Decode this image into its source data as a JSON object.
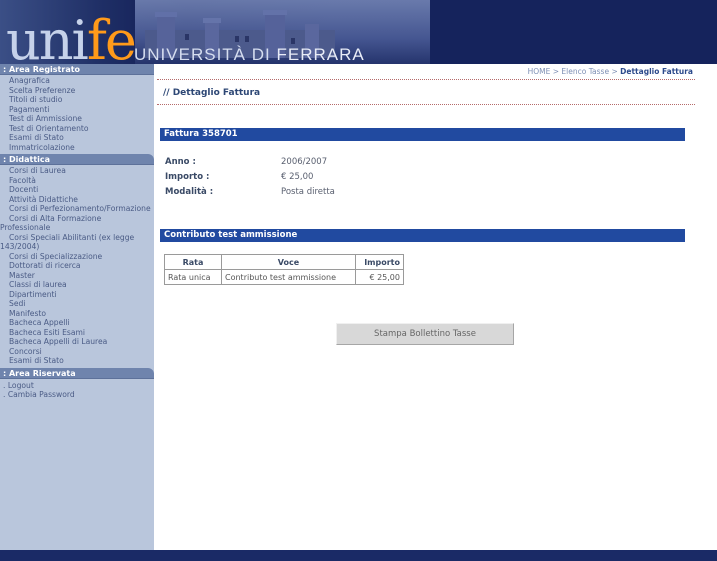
{
  "header": {
    "logo_main": "uni",
    "logo_accent": "fe",
    "logo_university": "UNIVERSITÀ DI",
    "logo_city": "FERRARA"
  },
  "sidebar": {
    "area_registrato": {
      "title": "Area Registrato",
      "items": [
        "Anagrafica",
        "Scelta Preferenze",
        "Titoli di studio",
        "Pagamenti",
        "Test di Ammissione",
        "Test di Orientamento",
        "Esami di Stato",
        "Immatricolazione"
      ]
    },
    "didattica": {
      "title": "Didattica",
      "items": [
        "Corsi di Laurea",
        "Facoltà",
        "Docenti",
        "Attività Didattiche",
        "Corsi di Perfezionamento/Formazione",
        "Corsi di Alta Formazione Professionale",
        "Corsi Speciali Abilitanti (ex legge 143/2004)",
        "Corsi di Specializzazione",
        "Dottorati di ricerca",
        "Master",
        "Classi di laurea",
        "Dipartimenti",
        "Sedi",
        "Manifesto",
        "Bacheca Appelli",
        "Bacheca Esiti Esami",
        "Bacheca Appelli di Laurea",
        "Concorsi",
        "Esami di Stato"
      ]
    },
    "area_riservata": {
      "title": "Area Riservata",
      "items": [
        "Logout",
        "Cambia Password"
      ]
    }
  },
  "breadcrumb": {
    "home": "HOME",
    "sep1": ">",
    "elenco": "Elenco Tasse",
    "sep2": ">",
    "current": "Dettaglio Fattura"
  },
  "page_title": "// Dettaglio Fattura",
  "fattura": {
    "title": "Fattura 358701",
    "anno_label": "Anno :",
    "anno_value": "2006/2007",
    "importo_label": "Importo :",
    "importo_value": "€ 25,00",
    "modalita_label": "Modalità :",
    "modalita_value": "Posta diretta"
  },
  "contributo": {
    "title": "Contributo test ammissione",
    "headers": [
      "Rata",
      "Voce",
      "Importo"
    ],
    "rows": [
      [
        "Rata unica",
        "Contributo test ammissione",
        "€ 25,00"
      ]
    ]
  },
  "stampa_button": "Stampa Bollettino Tasse"
}
